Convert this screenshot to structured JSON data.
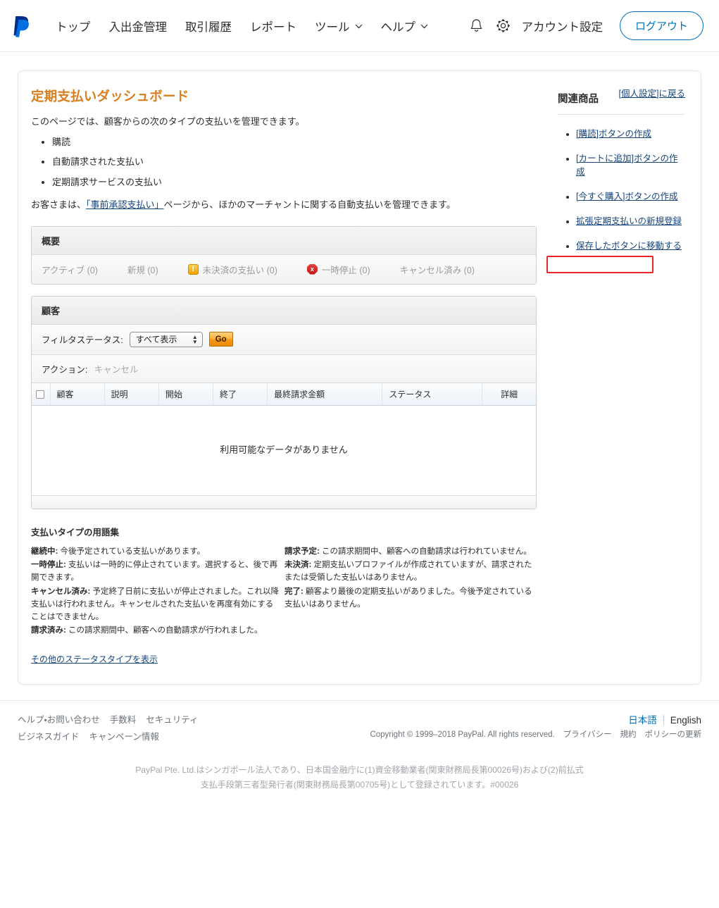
{
  "header": {
    "logo": "paypal-logo",
    "nav": [
      {
        "label": "トップ",
        "dropdown": false
      },
      {
        "label": "入出金管理",
        "dropdown": false
      },
      {
        "label": "取引履歴",
        "dropdown": false
      },
      {
        "label": "レポート",
        "dropdown": false
      },
      {
        "label": "ツール",
        "dropdown": true
      },
      {
        "label": "ヘルプ",
        "dropdown": true
      }
    ],
    "bell_icon": "bell-icon",
    "gear_icon": "gear-icon",
    "account_settings": "アカウント設定",
    "logout": "ログアウト"
  },
  "main": {
    "title": "定期支払いダッシュボード",
    "back_link": "[個人設定]に戻る",
    "intro": "このページでは、顧客からの次のタイプの支払いを管理できます。",
    "types": [
      "購読",
      "自動請求された支払い",
      "定期請求サービスの支払い"
    ],
    "note_before": "お客さまは、",
    "note_link": "「事前承認支払い」",
    "note_after": "ページから、ほかのマーチャントに関する自動支払いを管理できます。"
  },
  "overview": {
    "heading": "概要",
    "statuses": [
      {
        "label": "アクティブ (0)",
        "icon": null
      },
      {
        "label": "新規 (0)",
        "icon": null
      },
      {
        "label": "未決済の支払い (0)",
        "icon": "warning-icon",
        "icon_glyph": "!"
      },
      {
        "label": "一時停止 (0)",
        "icon": "stop-icon",
        "icon_glyph": "x"
      },
      {
        "label": "キャンセル済み (0)",
        "icon": null
      }
    ]
  },
  "customers": {
    "heading": "顧客",
    "filter_label": "フィルタステータス:",
    "filter_value": "すべて表示",
    "go_button": "Go",
    "action_label": "アクション:",
    "action_value": "キャンセル",
    "columns": [
      "顧客",
      "説明",
      "開始",
      "終了",
      "最終請求金額",
      "ステータス",
      "詳細"
    ],
    "empty_message": "利用可能なデータがありません",
    "rows": []
  },
  "glossary": {
    "title": "支払いタイプの用語集",
    "left": [
      {
        "term": "継続中:",
        "desc": " 今後予定されている支払いがあります。"
      },
      {
        "term": "一時停止:",
        "desc": " 支払いは一時的に停止されています。選択すると、後で再開できます。"
      },
      {
        "term": "キャンセル済み:",
        "desc": " 予定終了日前に支払いが停止されました。これ以降支払いは行われません。キャンセルされた支払いを再度有効にすることはできません。"
      },
      {
        "term": "請求済み:",
        "desc": " この請求期間中、顧客への自動請求が行われました。"
      }
    ],
    "right": [
      {
        "term": "請求予定:",
        "desc": " この請求期間中、顧客への自動請求は行われていません。"
      },
      {
        "term": "未決済:",
        "desc": " 定期支払いプロファイルが作成されていますが、請求されたまたは受領した支払いはありません。"
      },
      {
        "term": "完了:",
        "desc": " 顧客より最後の定期支払いがありました。今後予定されている支払いはありません。"
      }
    ],
    "more_link": "その他のステータスタイプを表示"
  },
  "sidebar": {
    "title": "関連商品",
    "items": [
      {
        "label": "[購読]ボタンの作成",
        "highlighted": true
      },
      {
        "label": "[カートに追加]ボタンの作成",
        "highlighted": false
      },
      {
        "label": "[今すぐ購入]ボタンの作成",
        "highlighted": false
      },
      {
        "label": "拡張定期支払いの新規登録",
        "highlighted": false
      },
      {
        "label": "保存したボタンに移動する",
        "highlighted": false
      }
    ],
    "highlight_color": "#e8262b"
  },
  "footer": {
    "links_row1": [
      "ヘルプ・お問い合わせ",
      "手数料",
      "セキュリティ"
    ],
    "links_row2": [
      "ビジネスガイド",
      "キャンペーン情報"
    ],
    "lang_ja": "日本語",
    "lang_en": "English",
    "copyright": "Copyright © 1999–2018 PayPal. All rights reserved.",
    "legal_links": [
      "プライバシー",
      "規約",
      "ポリシーの更新"
    ],
    "legal_line1": "PayPal Pte. Ltd.はシンガポール法人であり、日本国金融庁に(1)資金移動業者(関東財務局長第00026号)および(2)前払式",
    "legal_line2": "支払手段第三者型発行者(関東財務局長第00705号)として登録されています。#00026"
  },
  "colors": {
    "brand_blue": "#0070ba",
    "title_orange": "#d97e1e",
    "link_blue": "#16457e",
    "highlight_red": "#e8262b"
  }
}
